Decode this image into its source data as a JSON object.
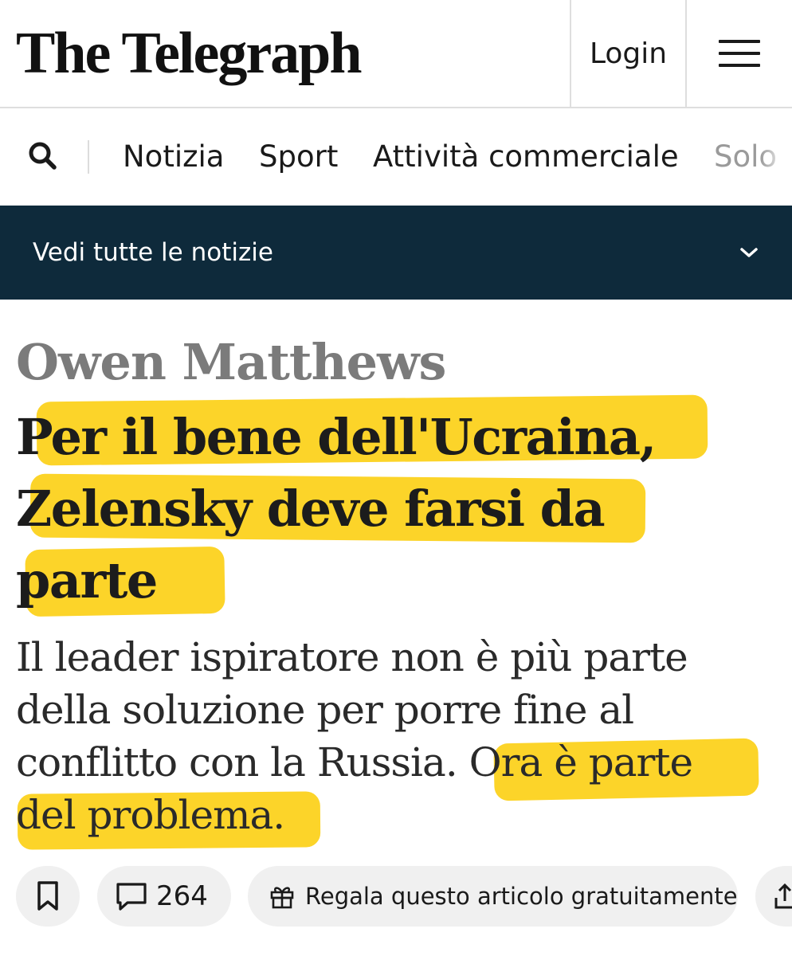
{
  "header": {
    "masthead": "The Telegraph",
    "login_label": "Login"
  },
  "nav": {
    "items": [
      "Notizia",
      "Sport",
      "Attività commerciale",
      "Soldi"
    ],
    "partial_item_visible": "Solo"
  },
  "banner": {
    "label": "Vedi tutte le notizie"
  },
  "article": {
    "author": "Owen Matthews",
    "headline_lines": [
      "Per il bene dell'Ucraina,",
      "Zelensky deve farsi da",
      "parte"
    ],
    "standfirst_lines": [
      "Il leader ispiratore non è più parte",
      "della soluzione per porre fine al",
      "conflitto con la Russia. Ora è parte",
      "del problema."
    ]
  },
  "actions": {
    "comment_count": "264",
    "gift_label": "Regala questo articolo gratuitamente"
  },
  "colors": {
    "banner_bg": "#0e2a3b",
    "highlight": "#fcd21e",
    "author_gray": "#7b7b7b"
  },
  "icons": [
    "search-icon",
    "hamburger-menu-icon",
    "chevron-down-icon",
    "bookmark-icon",
    "comment-icon",
    "gift-icon",
    "share-icon"
  ]
}
